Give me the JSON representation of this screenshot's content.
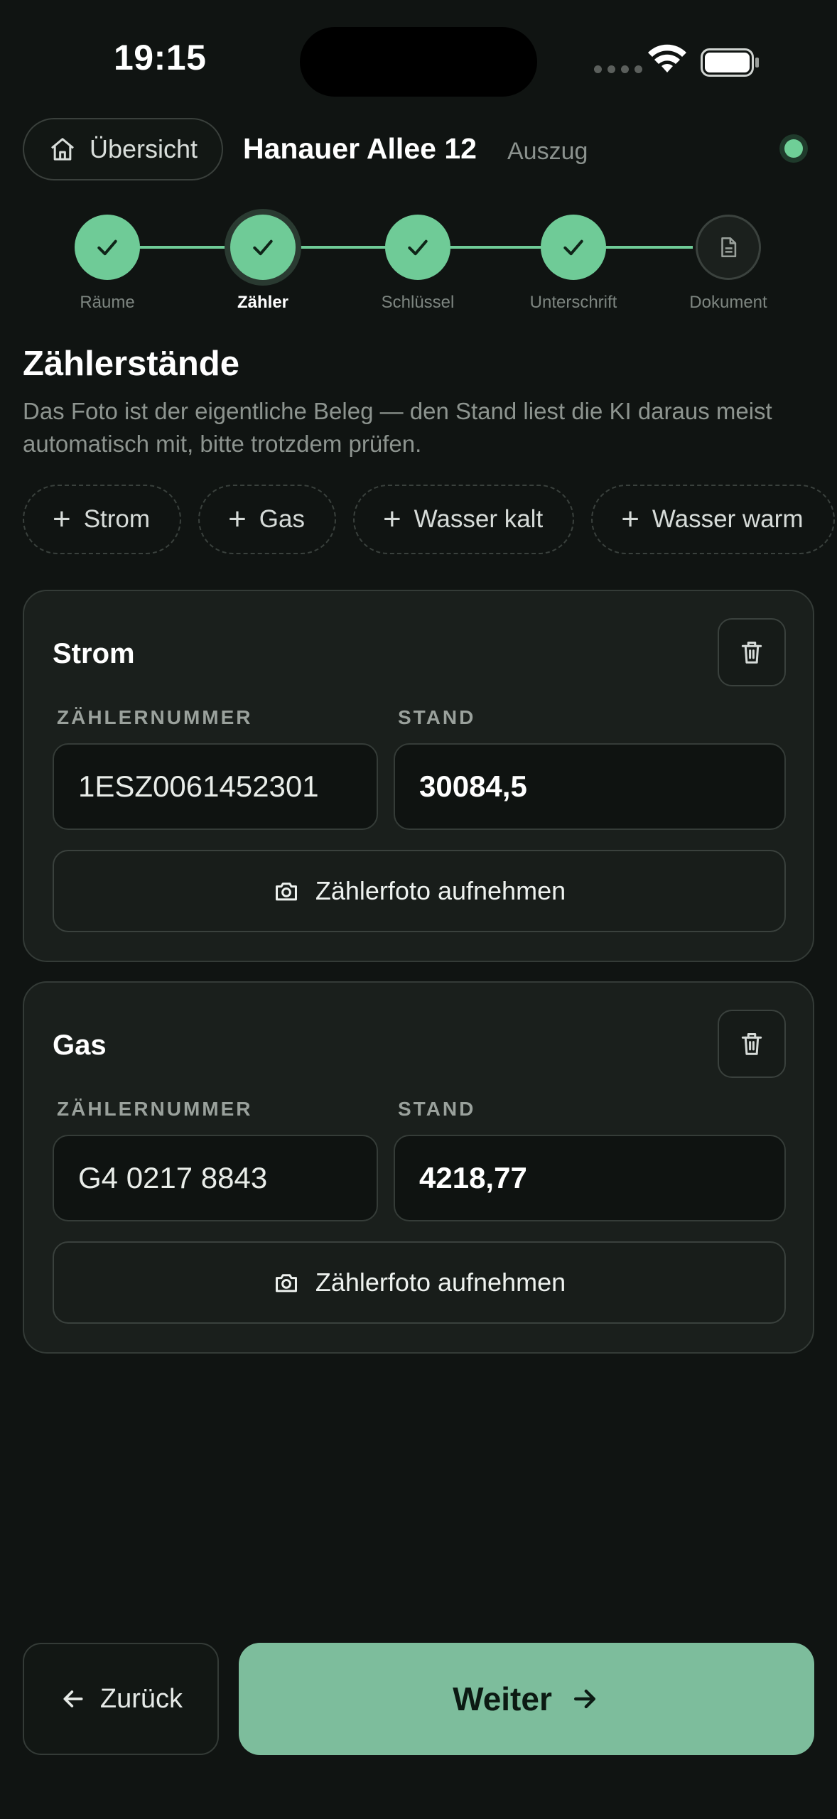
{
  "status_bar": {
    "time": "19:15"
  },
  "header": {
    "back_label": "Übersicht",
    "address": "Hanauer Allee 12",
    "mode": "Auszug",
    "sync_color": "#6fcf97"
  },
  "stepper": {
    "steps": [
      {
        "label": "Räume",
        "state": "done"
      },
      {
        "label": "Zähler",
        "state": "current"
      },
      {
        "label": "Schlüssel",
        "state": "done"
      },
      {
        "label": "Unterschrift",
        "state": "done"
      },
      {
        "label": "Dokument",
        "state": "pending"
      }
    ],
    "accent": "#6fcb97"
  },
  "section": {
    "title": "Zählerstände",
    "description": "Das Foto ist der eigentliche Beleg — den Stand liest die KI daraus meist automatisch mit, bitte trotzdem prüfen."
  },
  "add_chips": [
    {
      "label": "Strom"
    },
    {
      "label": "Gas"
    },
    {
      "label": "Wasser kalt"
    },
    {
      "label": "Wasser warm"
    }
  ],
  "meters": [
    {
      "title": "Strom",
      "number_label": "ZÄHLERNUMMER",
      "number": "1ESZ0061452301",
      "stand_label": "STAND",
      "stand": "30084,5",
      "photo_label": "Zählerfoto aufnehmen"
    },
    {
      "title": "Gas",
      "number_label": "ZÄHLERNUMMER",
      "number": "G4 0217 8843",
      "stand_label": "STAND",
      "stand": "4218,77",
      "photo_label": "Zählerfoto aufnehmen"
    }
  ],
  "footer": {
    "back_label": "Zurück",
    "next_label": "Weiter",
    "next_color": "#7dbd9c"
  }
}
